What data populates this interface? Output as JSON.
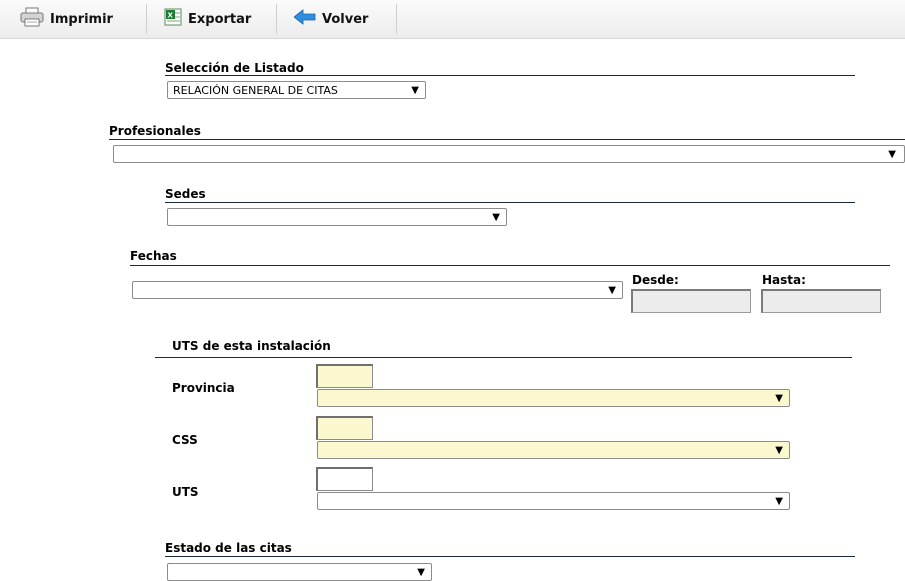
{
  "toolbar": {
    "print_label": "Imprimir",
    "export_label": "Exportar",
    "back_label": "Volver"
  },
  "listado": {
    "title": "Selección de Listado",
    "selected": "RELACIÓN GENERAL DE CITAS"
  },
  "profesionales": {
    "title": "Profesionales",
    "selected": ""
  },
  "sedes": {
    "title": "Sedes",
    "selected": ""
  },
  "fechas": {
    "title": "Fechas",
    "selected": "",
    "desde_label": "Desde:",
    "desde_value": "",
    "hasta_label": "Hasta:",
    "hasta_value": ""
  },
  "uts_section": {
    "title": "UTS de esta instalación",
    "provincia_label": "Provincia",
    "css_label": "CSS",
    "uts_label": "UTS"
  },
  "estado": {
    "title": "Estado de las citas",
    "selected": ""
  },
  "colors": {
    "highlight_yellow": "#fbf8cf",
    "rule_dark": "#1b2a3a",
    "back_arrow_blue": "#2f8ee0",
    "excel_green": "#1e7b34"
  },
  "icons": {
    "print": "printer-icon",
    "export": "excel-icon",
    "back": "back-arrow-icon",
    "dropdown": "triangle-down"
  }
}
